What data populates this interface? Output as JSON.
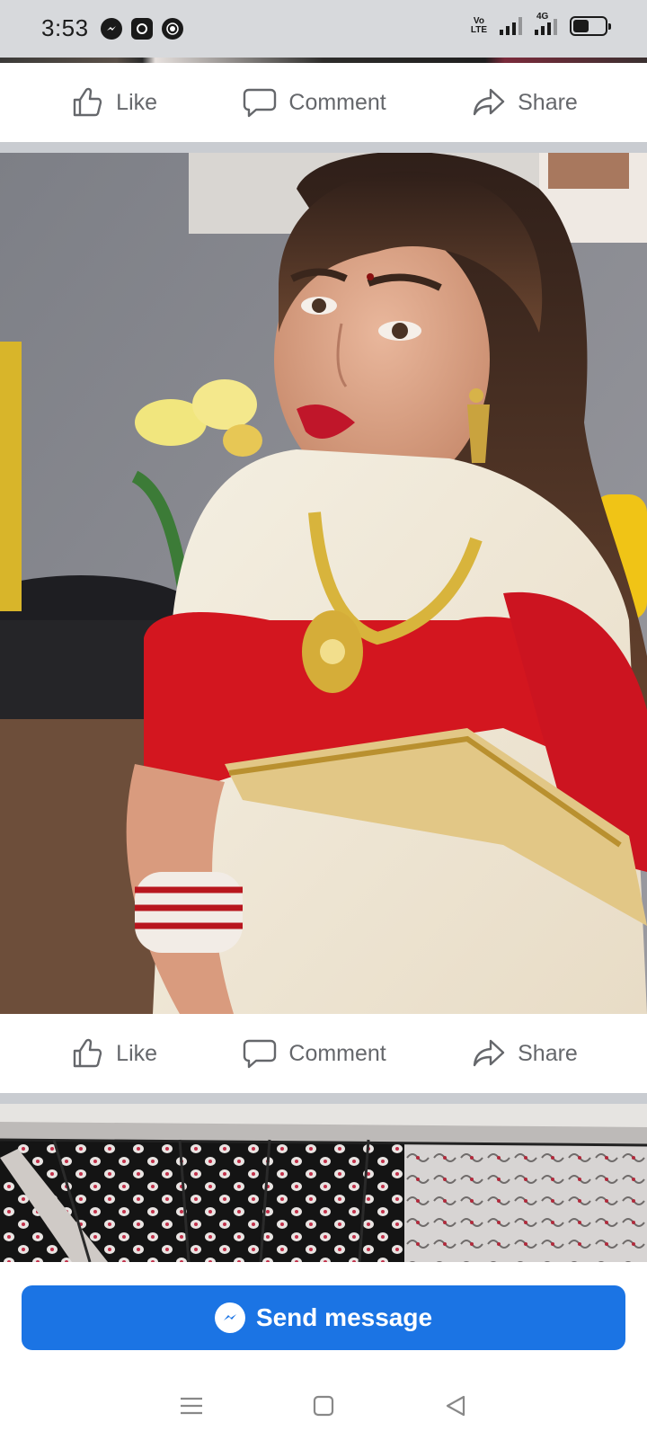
{
  "status_bar": {
    "time": "3:53",
    "left_icons": [
      "messenger-icon",
      "app-icon",
      "chrome-icon"
    ],
    "network": "Vo LTE",
    "network_type": "4G",
    "battery_level": 0.5
  },
  "post_top": {
    "actions": [
      {
        "label": "Like",
        "icon": "thumbs-up-icon"
      },
      {
        "label": "Comment",
        "icon": "comment-icon"
      },
      {
        "label": "Share",
        "icon": "share-icon"
      }
    ]
  },
  "post_main": {
    "photo": "woman-in-red-white-saree-photo",
    "actions": [
      {
        "label": "Like",
        "icon": "thumbs-up-icon"
      },
      {
        "label": "Comment",
        "icon": "comment-icon"
      },
      {
        "label": "Share",
        "icon": "share-icon"
      }
    ]
  },
  "next_post": {
    "photo": "black-white-saree-fabrics-photo"
  },
  "cta": {
    "send_message_label": "Send message",
    "color": "#1b74e4"
  },
  "nav": {
    "buttons": [
      "menu-icon",
      "home-square-icon",
      "back-triangle-icon"
    ]
  }
}
